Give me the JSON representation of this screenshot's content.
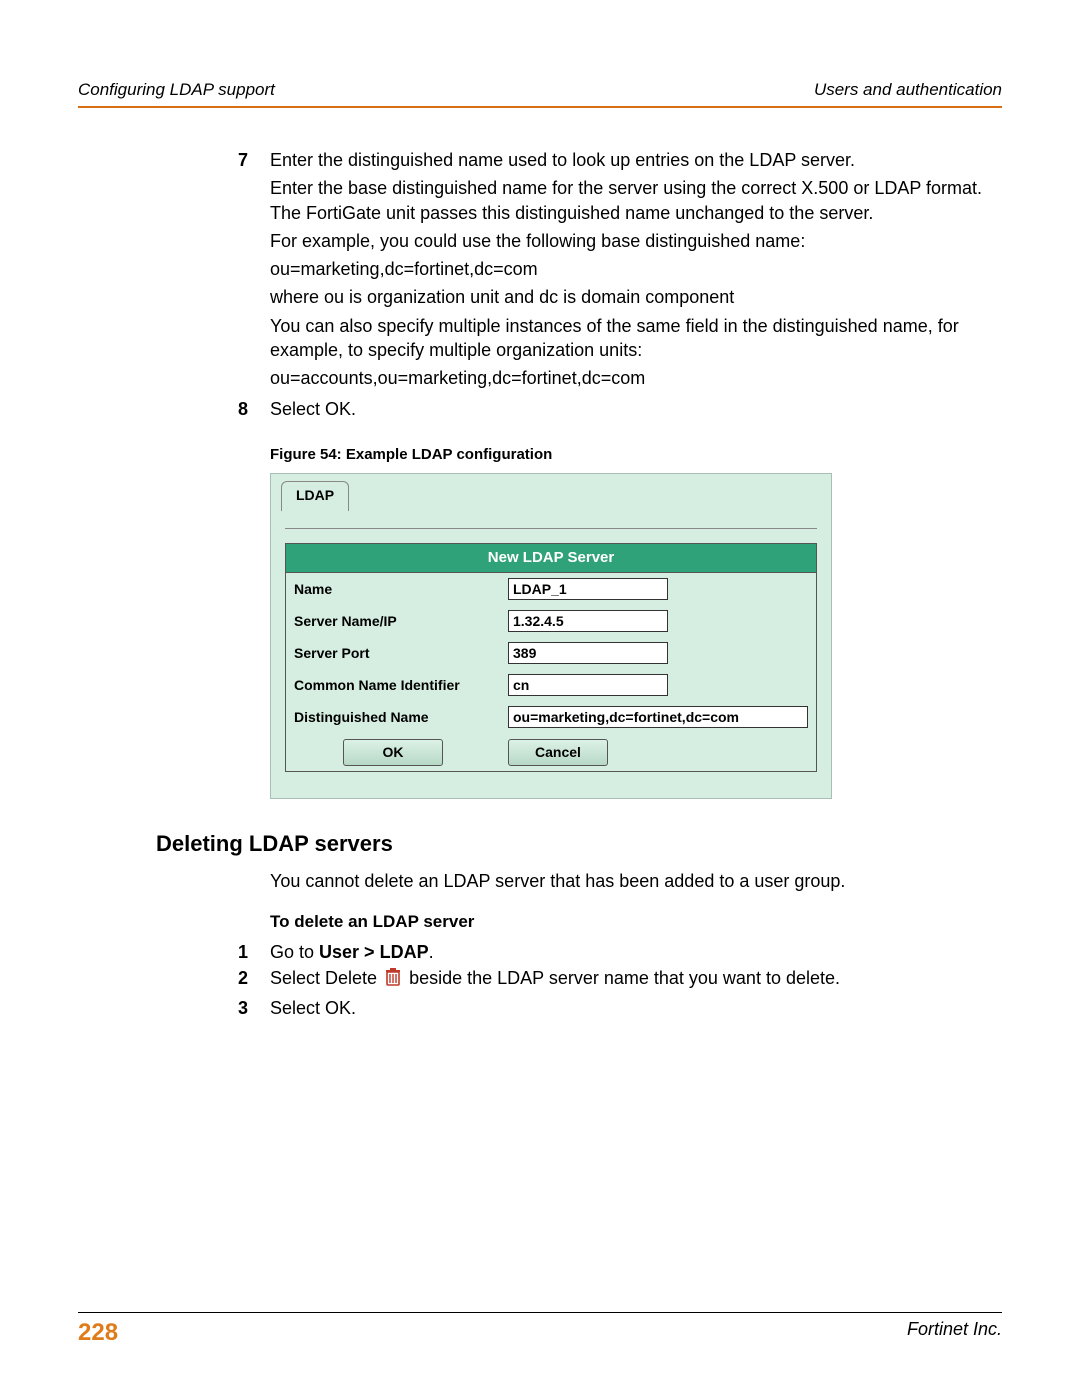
{
  "header": {
    "left": "Configuring LDAP support",
    "right": "Users and authentication"
  },
  "steps_top": [
    {
      "num": "7",
      "lines": [
        "Enter the distinguished name used to look up entries on the LDAP server.",
        "Enter the base distinguished name for the server using the correct X.500 or LDAP format. The FortiGate unit passes this distinguished name unchanged to the server.",
        "For example, you could use the following base distinguished name:",
        "ou=marketing,dc=fortinet,dc=com",
        "where ou is organization unit and dc is domain component",
        "You can also specify multiple instances of the same field in the distinguished name, for example, to specify multiple organization units:",
        "ou=accounts,ou=marketing,dc=fortinet,dc=com"
      ]
    },
    {
      "num": "8",
      "lines": [
        "Select OK."
      ]
    }
  ],
  "figure_caption": "Figure 54: Example LDAP configuration",
  "ldap_form": {
    "tab": "LDAP",
    "title": "New LDAP Server",
    "fields": {
      "name_label": "Name",
      "name_value": "LDAP_1",
      "server_label": "Server Name/IP",
      "server_value": "1.32.4.5",
      "port_label": "Server Port",
      "port_value": "389",
      "cni_label": "Common Name Identifier",
      "cni_value": "cn",
      "dn_label": "Distinguished Name",
      "dn_value": "ou=marketing,dc=fortinet,dc=com"
    },
    "ok": "OK",
    "cancel": "Cancel"
  },
  "section_heading": "Deleting LDAP servers",
  "section_intro": "You cannot delete an LDAP server that has been added to a user group.",
  "subheading": "To delete an LDAP server",
  "delete_steps": {
    "s1_num": "1",
    "s1_pre": "Go to ",
    "s1_bold": "User > LDAP",
    "s1_post": ".",
    "s2_num": "2",
    "s2_pre": "Select Delete ",
    "s2_post": " beside the LDAP server name that you want to delete.",
    "s3_num": "3",
    "s3_text": "Select OK."
  },
  "footer": {
    "page": "228",
    "right": "Fortinet Inc."
  }
}
